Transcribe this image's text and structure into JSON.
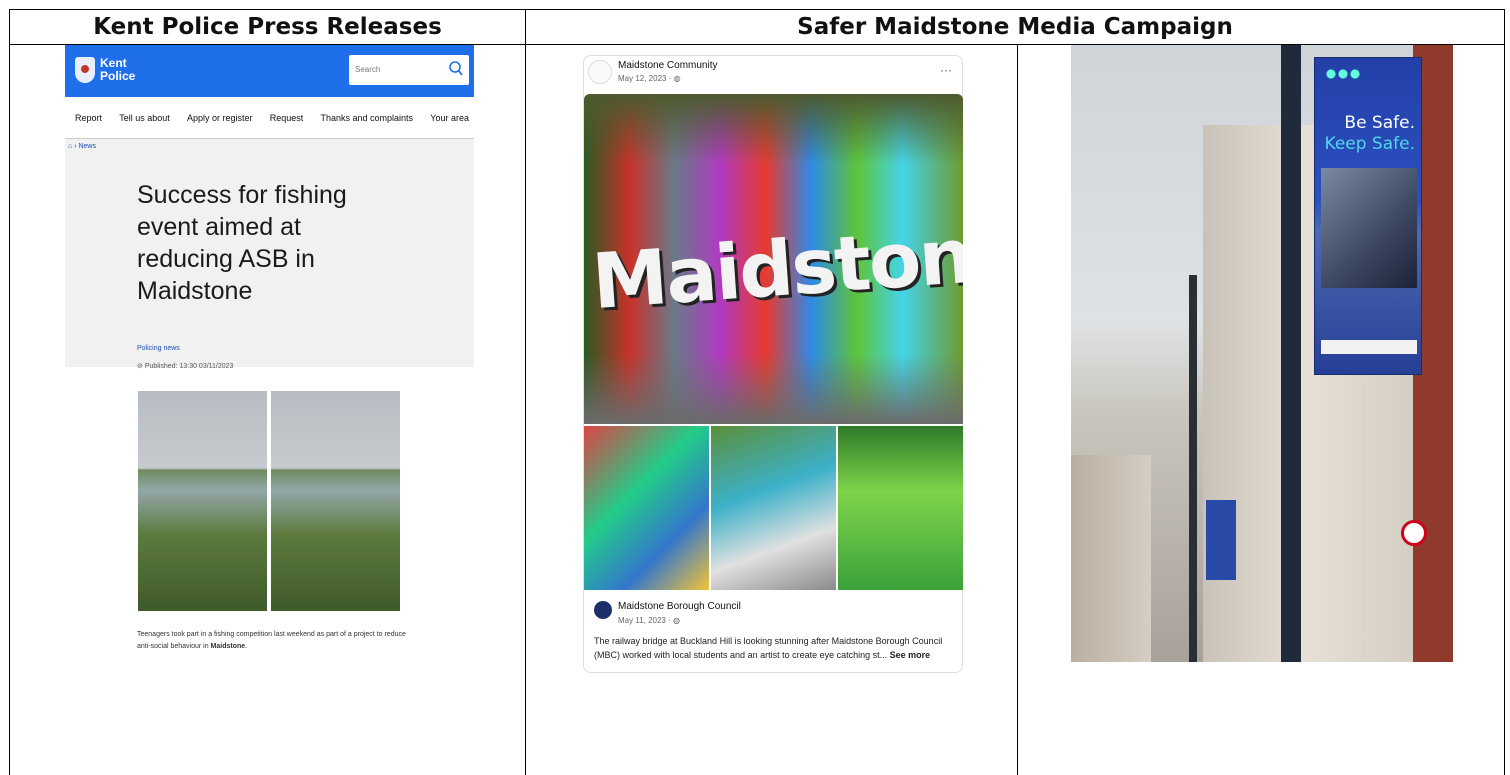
{
  "headers": {
    "left": "Kent Police Press Releases",
    "right": "Safer Maidstone Media Campaign"
  },
  "kent_police": {
    "brand_line1": "Kent",
    "brand_line2": "Police",
    "search_placeholder": "Search",
    "nav": [
      "Report",
      "Tell us about",
      "Apply or register",
      "Request",
      "Thanks and complaints",
      "Your area"
    ],
    "breadcrumb": "› News",
    "article_title": "Success for fishing event aimed at reducing ASB in Maidstone",
    "category": "Policing news",
    "published": "Published: 13:30 03/11/2023",
    "caption_part1": "Teenagers took part in a fishing competition last weekend as part of a project to reduce anti-social behaviour in ",
    "caption_bold": "Maidstone",
    "caption_end": "."
  },
  "facebook_post": {
    "page_name": "Maidstone Community",
    "post_date": "May 12, 2023 · ",
    "mural_text": "Maidston",
    "shared_page_name": "Maidstone Borough Council",
    "shared_date": "May 11, 2023 · ",
    "text": "The railway bridge at Buckland Hill is looking stunning after Maidstone Borough Council (MBC) worked with local students and an artist to create eye catching st... ",
    "see_more": "See more"
  },
  "banner": {
    "line1": "Be Safe.",
    "line2": "Keep Safe."
  },
  "colors": {
    "kent_blue": "#1f6fea",
    "facebook_text": "#111111"
  }
}
